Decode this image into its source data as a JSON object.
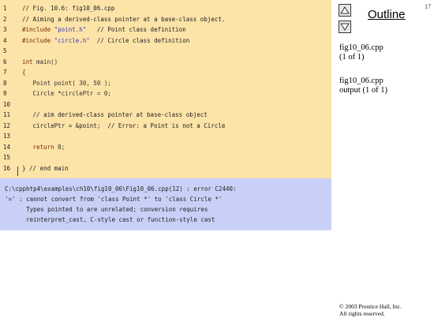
{
  "code_lines": [
    {
      "num": "1",
      "segments": [
        {
          "t": "// Fig. 10.6: fig10_06.cpp",
          "c": "comment"
        }
      ]
    },
    {
      "num": "2",
      "segments": [
        {
          "t": "// Aiming a derived-class pointer at a base-class object.",
          "c": "comment"
        }
      ]
    },
    {
      "num": "3",
      "segments": [
        {
          "t": "#include ",
          "c": "pp"
        },
        {
          "t": "\"point.h\"",
          "c": "str"
        },
        {
          "t": "   // Point class definition",
          "c": "comment"
        }
      ]
    },
    {
      "num": "4",
      "segments": [
        {
          "t": "#include ",
          "c": "pp"
        },
        {
          "t": "\"circle.h\"",
          "c": "str"
        },
        {
          "t": "  // Circle class definition",
          "c": "comment"
        }
      ]
    },
    {
      "num": "5",
      "segments": []
    },
    {
      "num": "6",
      "segments": [
        {
          "t": "int",
          "c": "kw"
        },
        {
          "t": " main()",
          "c": "plain"
        }
      ]
    },
    {
      "num": "7",
      "segments": [
        {
          "t": "{",
          "c": "plain"
        }
      ]
    },
    {
      "num": "8",
      "segments": [
        {
          "t": "   Point point( 30, 50 );",
          "c": "plain"
        }
      ]
    },
    {
      "num": "9",
      "segments": [
        {
          "t": "   Circle *circlePtr = 0;",
          "c": "plain"
        }
      ]
    },
    {
      "num": "10",
      "segments": []
    },
    {
      "num": "11",
      "segments": [
        {
          "t": "   // aim derived-class pointer at base-class object",
          "c": "comment"
        }
      ]
    },
    {
      "num": "12",
      "segments": [
        {
          "t": "   circlePtr = &point;  // Error: a Point is not a Circle",
          "c": "comment"
        }
      ]
    },
    {
      "num": "13",
      "segments": []
    },
    {
      "num": "14",
      "segments": [
        {
          "t": "   ",
          "c": "plain"
        },
        {
          "t": "return",
          "c": "kw"
        },
        {
          "t": " 0;",
          "c": "plain"
        }
      ]
    },
    {
      "num": "15",
      "segments": []
    },
    {
      "num": "16",
      "segments": [
        {
          "t": "} // end main",
          "c": "comment"
        }
      ]
    }
  ],
  "output_lines": [
    "C:\\cpphtp4\\examples\\ch10\\fig10_06\\Fig10_06.cpp(12) : error C2440:",
    "'=' : cannot convert from 'class Point *' to 'class Circle *'",
    "      Types pointed to are unrelated; conversion requires",
    "      reinterpret_cast, C-style cast or function-style cast"
  ],
  "sidebar": {
    "title": "Outline",
    "slide_number": "17",
    "entry1_line1": "fig10_06.cpp",
    "entry1_line2": "(1 of 1)",
    "entry2_line1": "fig10_06.cpp",
    "entry2_line2": "output (1 of 1)",
    "copyright_line1": "© 2003 Prentice Hall, Inc.",
    "copyright_line2": "All rights reserved."
  },
  "colors": {
    "code_bg": "#fce3a8",
    "output_bg": "#c9d0f7"
  }
}
